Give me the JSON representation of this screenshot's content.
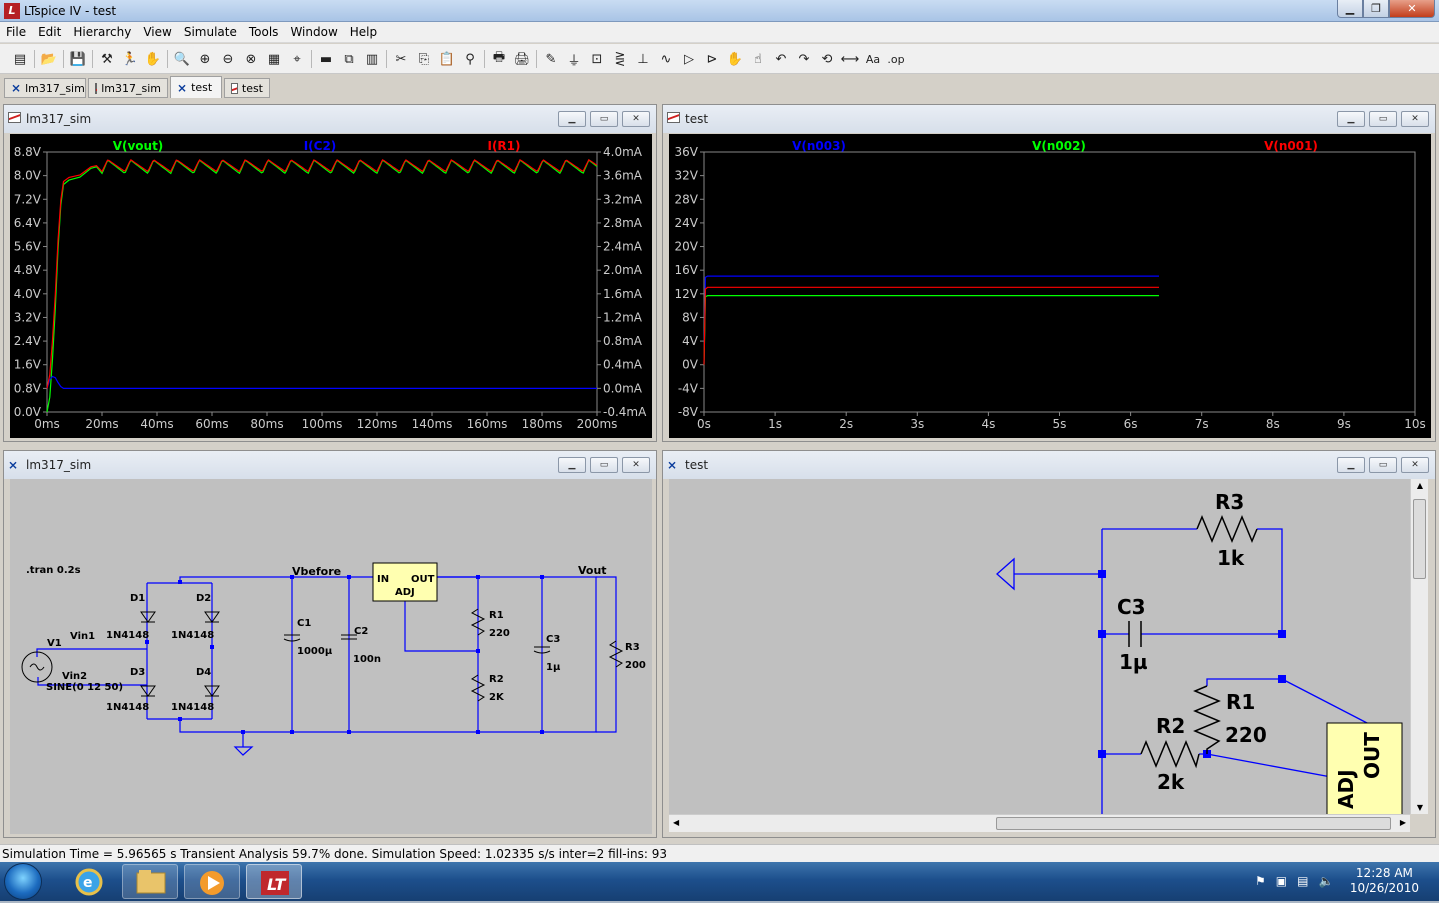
{
  "window": {
    "title": "LTspice IV - test"
  },
  "menu": [
    "File",
    "Edit",
    "Hierarchy",
    "View",
    "Simulate",
    "Tools",
    "Window",
    "Help"
  ],
  "toolbar_icons": [
    "new-schematic-icon",
    "open-icon",
    "save-icon",
    "control-panel-icon",
    "run-icon",
    "pan-icon",
    "zoom-in-icon",
    "zoom-extents-icon",
    "zoom-out-icon",
    "zoom-cancel-icon",
    "autorange-icon",
    "marker-icon",
    "tile-horizontal-icon",
    "cascade-icon",
    "tile-vertical-icon",
    "cut-icon",
    "copy-icon",
    "paste-icon",
    "find-icon",
    "print-setup-icon",
    "print-icon",
    "wire-icon",
    "ground-icon",
    "label-icon",
    "resistor-icon",
    "capacitor-icon",
    "inductor-icon",
    "diode-icon",
    "component-icon",
    "move-icon",
    "drag-icon",
    "undo-icon",
    "redo-icon",
    "rotate-icon",
    "mirror-icon",
    "text-icon",
    "spice-directive-icon"
  ],
  "tabs": [
    {
      "label": "lm317_sim",
      "kind": "schematic"
    },
    {
      "label": "lm317_sim",
      "kind": "plot"
    },
    {
      "label": "test",
      "kind": "schematic",
      "active": true
    },
    {
      "label": "test",
      "kind": "plot"
    }
  ],
  "panes": {
    "plot1": {
      "title": "lm317_sim"
    },
    "plot2": {
      "title": "test"
    },
    "sch1": {
      "title": "lm317_sim"
    },
    "sch2": {
      "title": "test"
    }
  },
  "chart_data": [
    {
      "type": "line",
      "title": "",
      "legend": [
        "V(vout)",
        "I(C2)",
        "I(R1)"
      ],
      "legend_colors": [
        "#00ff00",
        "#0000ff",
        "#ff0000"
      ],
      "x_ticks": [
        "0ms",
        "20ms",
        "40ms",
        "60ms",
        "80ms",
        "100ms",
        "120ms",
        "140ms",
        "160ms",
        "180ms",
        "200ms"
      ],
      "y_left_ticks": [
        "8.8V",
        "8.0V",
        "7.2V",
        "6.4V",
        "5.6V",
        "4.8V",
        "4.0V",
        "3.2V",
        "2.4V",
        "1.6V",
        "0.8V",
        "0.0V"
      ],
      "y_right_ticks": [
        "4.0mA",
        "3.6mA",
        "3.2mA",
        "2.8mA",
        "2.4mA",
        "2.0mA",
        "1.6mA",
        "1.2mA",
        "0.8mA",
        "0.4mA",
        "0.0mA",
        "-0.4mA"
      ],
      "xlim": [
        0,
        200
      ],
      "ylim_left": [
        0,
        8.8
      ],
      "ylim_right": [
        -0.4,
        4.0
      ],
      "series": [
        {
          "name": "V(vout)",
          "color": "#00ff00",
          "x": [
            0,
            1,
            2,
            3,
            4,
            5,
            6,
            8,
            10,
            12,
            14,
            16,
            18,
            20,
            200
          ],
          "y": [
            0,
            0.5,
            1.8,
            3.5,
            5.5,
            7.0,
            7.7,
            7.85,
            7.9,
            7.95,
            8.1,
            8.25,
            8.3,
            8.3,
            8.3
          ],
          "ripple": {
            "period_ms": 8.33,
            "amplitude_v": 0.45
          }
        },
        {
          "name": "I(C2)",
          "color": "#0000ff",
          "x": [
            0,
            1,
            2,
            3,
            4,
            5,
            6,
            8,
            10,
            200
          ],
          "y": [
            0,
            0.15,
            0.2,
            0.18,
            0.1,
            0.03,
            0.0,
            0.0,
            0.0,
            0.0
          ]
        },
        {
          "name": "I(R1)",
          "color": "#ff0000",
          "x": [
            0,
            1,
            2,
            3,
            4,
            5,
            6,
            8,
            10,
            12,
            14,
            16,
            18,
            20,
            200
          ],
          "y": [
            0,
            0.23,
            0.82,
            1.59,
            2.5,
            3.18,
            3.5,
            3.57,
            3.59,
            3.61,
            3.68,
            3.75,
            3.77,
            3.77,
            3.77
          ],
          "ripple": {
            "period_ms": 8.33,
            "amplitude_ma": 0.2
          }
        }
      ]
    },
    {
      "type": "line",
      "title": "",
      "legend": [
        "V(n003)",
        "V(n002)",
        "V(n001)"
      ],
      "legend_colors": [
        "#0000ff",
        "#00ff00",
        "#ff0000"
      ],
      "x_ticks": [
        "0s",
        "1s",
        "2s",
        "3s",
        "4s",
        "5s",
        "6s",
        "7s",
        "8s",
        "9s",
        "10s"
      ],
      "y_left_ticks": [
        "36V",
        "32V",
        "28V",
        "24V",
        "20V",
        "16V",
        "12V",
        "8V",
        "4V",
        "0V",
        "-4V",
        "-8V"
      ],
      "xlim": [
        0,
        10
      ],
      "ylim_left": [
        -8,
        36
      ],
      "series": [
        {
          "name": "V(n003)",
          "color": "#0000ff",
          "x": [
            0,
            0.02,
            0.05,
            6.4
          ],
          "y": [
            0,
            14.8,
            15.0,
            15.0
          ]
        },
        {
          "name": "V(n002)",
          "color": "#00ff00",
          "x": [
            0,
            0.02,
            0.05,
            6.4
          ],
          "y": [
            0,
            11.5,
            11.7,
            11.7
          ]
        },
        {
          "name": "V(n001)",
          "color": "#ff0000",
          "x": [
            0,
            0.02,
            0.05,
            6.4
          ],
          "y": [
            0,
            12.8,
            13.1,
            13.1
          ]
        }
      ]
    }
  ],
  "schematic1": {
    "labels": {
      "tran": ".tran 0.2s",
      "vbefore": "Vbefore",
      "vout": "Vout",
      "vin1": "Vin1",
      "vin2": "Vin2",
      "v1": "V1",
      "sine": "SINE(0 12 50)",
      "d1": "D1",
      "d2": "D2",
      "d3": "D3",
      "d4": "D4",
      "d1m": "1N4148",
      "d2m": "1N4148",
      "d3m": "1N4148",
      "d4m": "1N4148",
      "c1": "C1",
      "c1v": "1000µ",
      "c2": "C2",
      "c2v": "100n",
      "c3": "C3",
      "c3v": "1µ",
      "r1": "R1",
      "r1v": "220",
      "r2": "R2",
      "r2v": "2K",
      "r3": "R3",
      "r3v": "200",
      "reg_in": "IN",
      "reg_out": "OUT",
      "reg_adj": "ADJ"
    }
  },
  "schematic2": {
    "labels": {
      "r3": "R3",
      "r3v": "1k",
      "c3": "C3",
      "c3v": "1µ",
      "r1": "R1",
      "r1v": "220",
      "r2": "R2",
      "r2v": "2k",
      "adj": "ADJ",
      "out": "OUT"
    }
  },
  "status": {
    "text": "Simulation Time = 5.96565 s  Transient Analysis 59.7% done. Simulation Speed: 1.02335 s/s inter=2 fill-ins: 93"
  },
  "taskbar": {
    "time": "12:28 AM",
    "date": "10/26/2010",
    "apps": [
      "internet-explorer-icon",
      "explorer-icon",
      "media-player-icon",
      "ltspice-icon"
    ]
  }
}
